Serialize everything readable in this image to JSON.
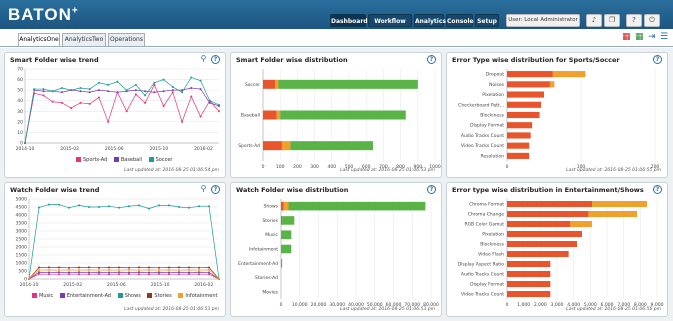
{
  "app": {
    "logo": "BATON",
    "logo_sup": "+"
  },
  "nav": {
    "items": [
      {
        "label": "Dashboard",
        "active": true
      },
      {
        "label": "Workflow QC",
        "active": false
      },
      {
        "label": "Analytics",
        "active": false
      },
      {
        "label": "Console",
        "active": false
      },
      {
        "label": "Setup",
        "active": false
      }
    ],
    "user": "User: Local Administrator",
    "icons": [
      "bell-icon",
      "copy-icon",
      "help-icon",
      "power-icon"
    ]
  },
  "tabs": [
    "AnalyticsOne",
    "AnalyticsTwo",
    "Operations"
  ],
  "active_tab": "AnalyticsOne",
  "colors": {
    "pink": "#e6337a",
    "purple": "#7c3ab0",
    "teal": "#1e9b96",
    "brown": "#8b3a1e",
    "orange": "#f0a12c",
    "green": "#5ab346",
    "red": "#e8552d"
  },
  "panels": {
    "p1": {
      "title": "Smart Folder wise trend",
      "updated": "Last updated at: 2016-08-25 01:06:54 pm"
    },
    "p2": {
      "title": "Smart Folder wise distribution",
      "updated": "Last updated at: 2016-08-25 01:06:53 pm"
    },
    "p3": {
      "title": "Error Type wise distribution for Sports/Soccer",
      "updated": "Last updated at: 2016-08-25 01:06:55 pm"
    },
    "p4": {
      "title": "Watch Folder wise trend",
      "updated": "Last updated at: 2016-08-25 01:06:53 pm"
    },
    "p5": {
      "title": "Watch Folder wise distribution",
      "updated": "Last updated at: 2016-08-25 01:06:53 pm"
    },
    "p6": {
      "title": "Error type wise distribution in Entertainment/Shows",
      "updated": "Last updated at: 2016-08-25 01:06:56 pm"
    }
  },
  "chart_data": [
    {
      "type": "line",
      "x_ticks": [
        "2014-10",
        "2015-02",
        "2015-06",
        "2015-10",
        "2016-02"
      ],
      "ylim": [
        0,
        70
      ],
      "y_ticks": [
        0,
        10,
        20,
        30,
        40,
        50,
        60,
        70
      ],
      "series": [
        {
          "name": "Sports-Ad",
          "color": "#e6337a",
          "values": [
            0,
            47,
            45,
            39,
            38,
            33,
            38,
            37,
            43,
            20,
            48,
            30,
            46,
            38,
            55,
            35,
            48,
            20,
            44,
            25,
            40,
            30
          ]
        },
        {
          "name": "Baseball",
          "color": "#7c3ab0",
          "values": [
            0,
            50,
            49,
            49,
            48,
            50,
            49,
            48,
            50,
            49,
            48,
            49,
            50,
            49,
            48,
            49,
            50,
            50,
            52,
            51,
            38,
            35
          ]
        },
        {
          "name": "Soccer",
          "color": "#1e9b96",
          "values": [
            0,
            51,
            51,
            49,
            52,
            50,
            52,
            51,
            57,
            55,
            58,
            50,
            55,
            45,
            57,
            60,
            53,
            48,
            62,
            59,
            40,
            36
          ]
        }
      ]
    },
    {
      "type": "bar",
      "orientation": "horizontal",
      "categories": [
        "Soccer",
        "Baseball",
        "Sports-Ad"
      ],
      "xlim": [
        0,
        1000
      ],
      "x_ticks": [
        0,
        100,
        200,
        300,
        400,
        500,
        600,
        700,
        800,
        900,
        1000
      ],
      "series": [
        {
          "color": "#e8552d",
          "values": [
            70,
            80,
            110
          ]
        },
        {
          "color": "#f0a12c",
          "values": [
            20,
            20,
            50
          ]
        },
        {
          "color": "#5ab346",
          "values": [
            810,
            730,
            480
          ]
        }
      ]
    },
    {
      "type": "bar",
      "orientation": "horizontal",
      "categories": [
        "Dropout",
        "Noises",
        "Pixelation",
        "Checkerboard Patt...",
        "Blockiness",
        "Display Format",
        "Audio Tracks Count",
        "Video Tracks Count",
        "Resolution"
      ],
      "xlim": [
        0,
        200
      ],
      "x_ticks": [
        0,
        100,
        200
      ],
      "series": [
        {
          "color": "#e8552d",
          "values": [
            62,
            58,
            50,
            46,
            44,
            34,
            32,
            30,
            30
          ]
        },
        {
          "color": "#f0a12c",
          "values": [
            44,
            6,
            0,
            0,
            0,
            0,
            0,
            0,
            0
          ]
        }
      ]
    },
    {
      "type": "line",
      "x_ticks": [
        "2014-10",
        "2015-02",
        "2015-06",
        "2015-10",
        "2016-02"
      ],
      "ylim": [
        0,
        5000
      ],
      "y_ticks": [
        0,
        500,
        1000,
        1500,
        2000,
        2500,
        3000,
        3500,
        4000,
        4500,
        5000
      ],
      "series": [
        {
          "name": "Music",
          "color": "#e6337a",
          "values": [
            0,
            310,
            300,
            300,
            310,
            300,
            300,
            310,
            300,
            300,
            310,
            300,
            300,
            310,
            300,
            300,
            310,
            300,
            300,
            0
          ]
        },
        {
          "name": "Entertainment-Ad",
          "color": "#7c3ab0",
          "values": [
            0,
            420,
            410,
            420,
            410,
            420,
            410,
            420,
            410,
            420,
            410,
            420,
            410,
            420,
            410,
            420,
            410,
            420,
            410,
            0
          ]
        },
        {
          "name": "Shows",
          "color": "#1e9b96",
          "values": [
            0,
            4470,
            4650,
            4650,
            4450,
            4600,
            4500,
            4500,
            4550,
            4450,
            4550,
            4600,
            4400,
            4600,
            4600,
            4500,
            4450,
            4550,
            4550,
            0
          ]
        },
        {
          "name": "Stories",
          "color": "#8b3a1e",
          "values": [
            0,
            720,
            730,
            720,
            700,
            720,
            730,
            700,
            720,
            720,
            700,
            730,
            720,
            700,
            720,
            730,
            720,
            700,
            720,
            0
          ]
        },
        {
          "name": "Infotainment",
          "color": "#f0a12c",
          "values": [
            0,
            560,
            570,
            560,
            570,
            560,
            570,
            560,
            570,
            560,
            570,
            560,
            570,
            560,
            570,
            560,
            570,
            560,
            570,
            0
          ]
        }
      ]
    },
    {
      "type": "bar",
      "orientation": "horizontal",
      "categories": [
        "Shows",
        "Stories",
        "Music",
        "Infotainment",
        "Entertainment-Ad",
        "Stories-Ad",
        "Movies"
      ],
      "xlim": [
        0,
        80000
      ],
      "x_ticks": [
        "0",
        "10,000",
        "20,000",
        "30,000",
        "40,000",
        "50,000",
        "60,000",
        "70,000",
        "80,000"
      ],
      "series": [
        {
          "color": "#e8552d",
          "values": [
            1500,
            600,
            400,
            300,
            0,
            0,
            0
          ]
        },
        {
          "color": "#f0a12c",
          "values": [
            2500,
            0,
            0,
            0,
            0,
            0,
            0
          ]
        },
        {
          "color": "#5ab346",
          "values": [
            73000,
            6500,
            5100,
            5200,
            600,
            0,
            0
          ]
        }
      ]
    },
    {
      "type": "bar",
      "orientation": "horizontal",
      "categories": [
        "Chroma Format",
        "Chroma Change",
        "RGB Color Gamut",
        "Pixelation",
        "Blockiness",
        "Video Flash",
        "Display Aspect Ratio",
        "Audio Tracks Count",
        "Display Format",
        "Video Tracks Count"
      ],
      "xlim": [
        0,
        9000
      ],
      "x_ticks": [
        "0",
        "1,000",
        "2,000",
        "3,000",
        "4,000",
        "5,000",
        "6,000",
        "7,000",
        "8,000",
        "9,000"
      ],
      "series": [
        {
          "color": "#e8552d",
          "values": [
            5100,
            4900,
            3800,
            4500,
            4200,
            3700,
            2600,
            2600,
            2600,
            2600
          ]
        },
        {
          "color": "#f0a12c",
          "values": [
            3300,
            2900,
            1300,
            0,
            0,
            0,
            0,
            0,
            0,
            0
          ]
        }
      ]
    }
  ]
}
